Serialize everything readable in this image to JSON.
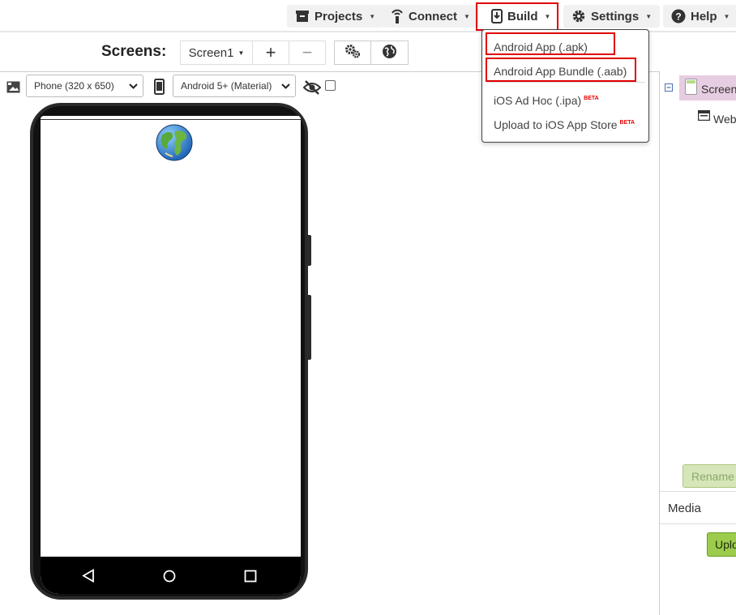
{
  "topbar": {
    "menus": [
      {
        "label": "Projects",
        "icon": "folder-icon"
      },
      {
        "label": "Connect",
        "icon": "signal-icon"
      },
      {
        "label": "Build",
        "icon": "download-phone-icon"
      },
      {
        "label": "Settings",
        "icon": "gear-icon"
      },
      {
        "label": "Help",
        "icon": "help-icon"
      }
    ],
    "highlight_color": "#e00000"
  },
  "build_dropdown": {
    "items": [
      {
        "label": "Android App (.apk)"
      },
      {
        "label": "Android App Bundle (.aab)"
      },
      {
        "label": "iOS Ad Hoc (.ipa)",
        "badge": "BETA"
      },
      {
        "label": "Upload to iOS App Store",
        "badge": "BETA"
      }
    ]
  },
  "screens": {
    "label": "Screens:",
    "current": "Screen1",
    "add": "+",
    "remove": "−"
  },
  "viewer": {
    "size_option": "Phone (320 x 650)",
    "theme_option": "Android 5+ (Material)",
    "hidden_checkbox_checked": false
  },
  "right_panel": {
    "tree_root": "Screen",
    "tree_child": "Web",
    "rename_button": "Rename",
    "media_label": "Media",
    "upload_button": "Upload"
  },
  "colors": {
    "accent_red": "#e00000",
    "green_button": "#9ccc4b",
    "selected_tree": "#e7cde1"
  }
}
